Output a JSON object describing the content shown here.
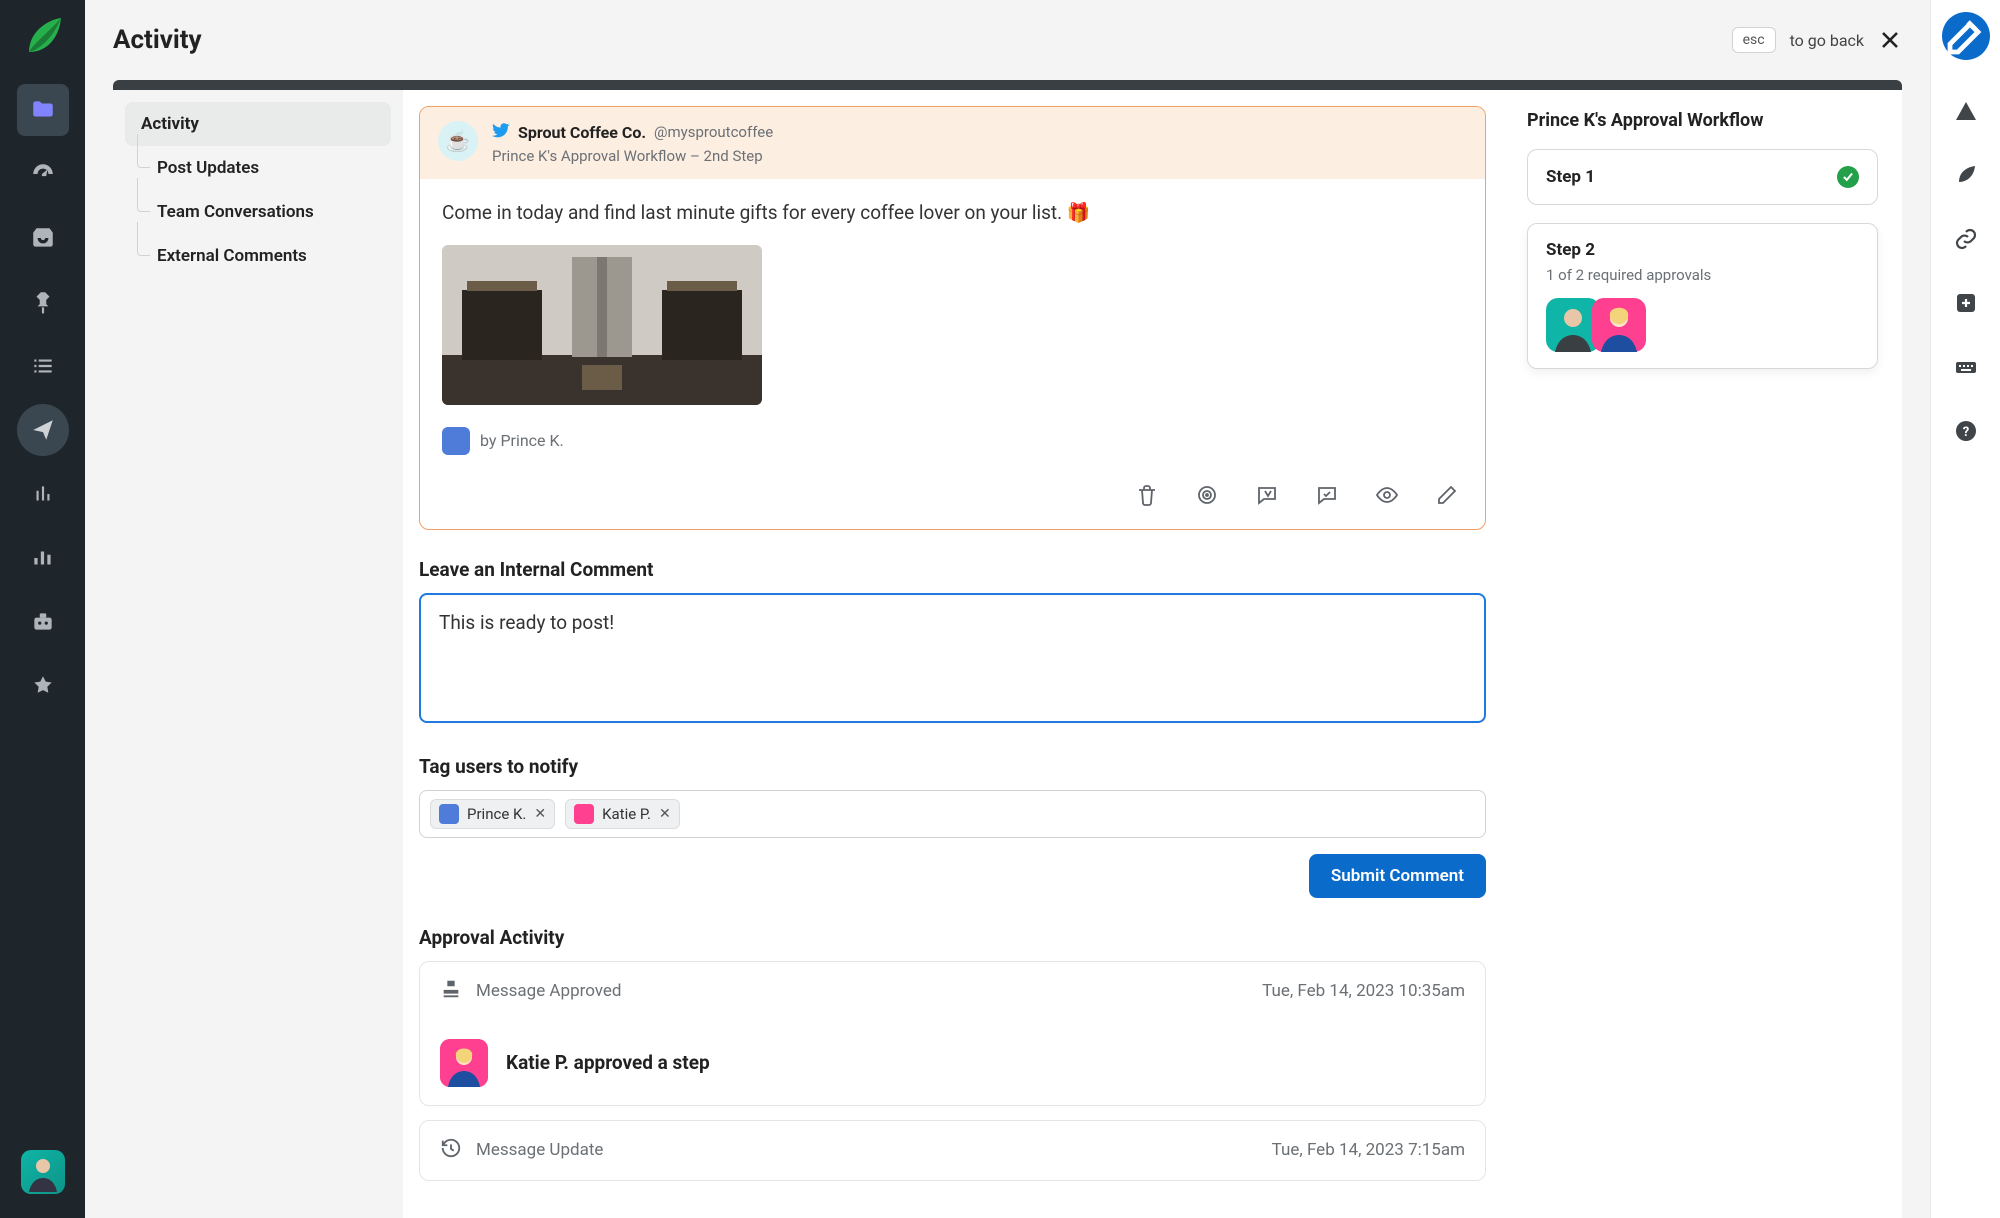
{
  "header": {
    "title": "Activity",
    "esc_label": "esc",
    "back_text": "to go back"
  },
  "left_nav": {
    "items": [
      {
        "name": "folder",
        "active": true
      },
      {
        "name": "dashboard"
      },
      {
        "name": "inbox"
      },
      {
        "name": "pin"
      },
      {
        "name": "list"
      },
      {
        "name": "send",
        "circle": true
      },
      {
        "name": "pulse"
      },
      {
        "name": "bars"
      },
      {
        "name": "bot"
      },
      {
        "name": "star"
      }
    ]
  },
  "subnav": {
    "root": "Activity",
    "children": [
      "Post Updates",
      "Team Conversations",
      "External Comments"
    ]
  },
  "post": {
    "brand_emoji": "☕",
    "brand_name": "Sprout Coffee Co.",
    "brand_handle": "@mysproutcoffee",
    "workflow_line": "Prince K's Approval Workflow – 2nd Step",
    "text": "Come in today and find last minute gifts for every coffee lover on your list. 🎁",
    "byline": "by Prince K.",
    "actions": [
      "delete",
      "target",
      "reply",
      "comment",
      "eye",
      "edit"
    ]
  },
  "comment": {
    "section_title": "Leave an Internal Comment",
    "value": "This is ready to post!"
  },
  "tag": {
    "section_title": "Tag users to notify",
    "chips": [
      "Prince K.",
      "Katie P."
    ]
  },
  "submit_label": "Submit Comment",
  "approval": {
    "section_title": "Approval Activity",
    "items": [
      {
        "icon": "stamp",
        "label": "Message Approved",
        "time": "Tue, Feb 14, 2023 10:35am",
        "detail_text": "Katie P. approved a step"
      },
      {
        "icon": "history",
        "label": "Message Update",
        "time": "Tue, Feb 14, 2023 7:15am"
      }
    ]
  },
  "workflow": {
    "title": "Prince K's Approval Workflow",
    "steps": [
      {
        "label": "Step 1",
        "done": true
      },
      {
        "label": "Step 2",
        "sub": "1 of 2 required approvals",
        "approvers": 2
      }
    ]
  }
}
